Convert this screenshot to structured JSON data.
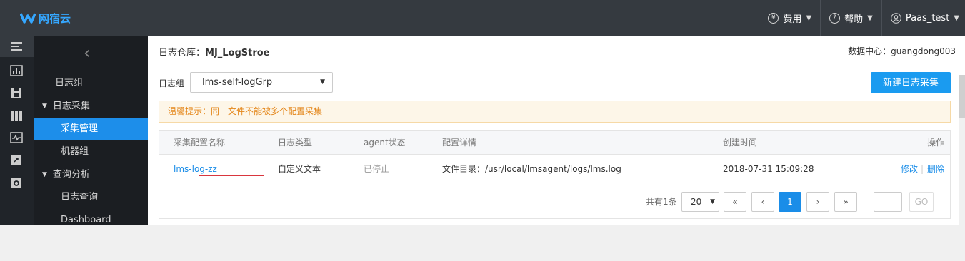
{
  "brand": {
    "name": "网宿云",
    "color": "#35a7ff"
  },
  "topnav": {
    "cost": "费用",
    "help": "帮助",
    "user": "Paas_test",
    "cost_icon": "yen-icon",
    "help_icon": "question-icon",
    "user_icon": "user-icon"
  },
  "sidebar": {
    "collapse_icon": "chevron-left-icon",
    "items": [
      {
        "label": "日志组"
      },
      {
        "label": "日志采集"
      },
      {
        "label": "采集管理"
      },
      {
        "label": "机器组"
      },
      {
        "label": "查询分析"
      },
      {
        "label": "日志查询"
      },
      {
        "label": "Dashboard"
      }
    ]
  },
  "header": {
    "repo_label": "日志仓库：",
    "repo_name": "MJ_LogStroe",
    "dc_label": "数据中心：",
    "dc_value": "guangdong003"
  },
  "filter": {
    "label": "日志组",
    "selected": "lms-self-logGrp"
  },
  "new_button": "新建日志采集",
  "notice": "温馨提示：同一文件不能被多个配置采集",
  "table": {
    "headers": [
      "采集配置名称",
      "日志类型",
      "agent状态",
      "配置详情",
      "创建时间",
      "操作"
    ],
    "rows": [
      {
        "name": "lms-log-zz",
        "type": "自定义文本",
        "status": "已停止",
        "detail": "文件目录：/usr/local/lmsagent/logs/lms.log",
        "created": "2018-07-31 15:09:28",
        "edit": "修改",
        "sep": "|",
        "delete": "删除"
      }
    ]
  },
  "pager": {
    "total": "共有1条",
    "page_size": "20",
    "first": "«",
    "prev": "‹",
    "current": "1",
    "next": "›",
    "last": "»",
    "go": "GO"
  }
}
